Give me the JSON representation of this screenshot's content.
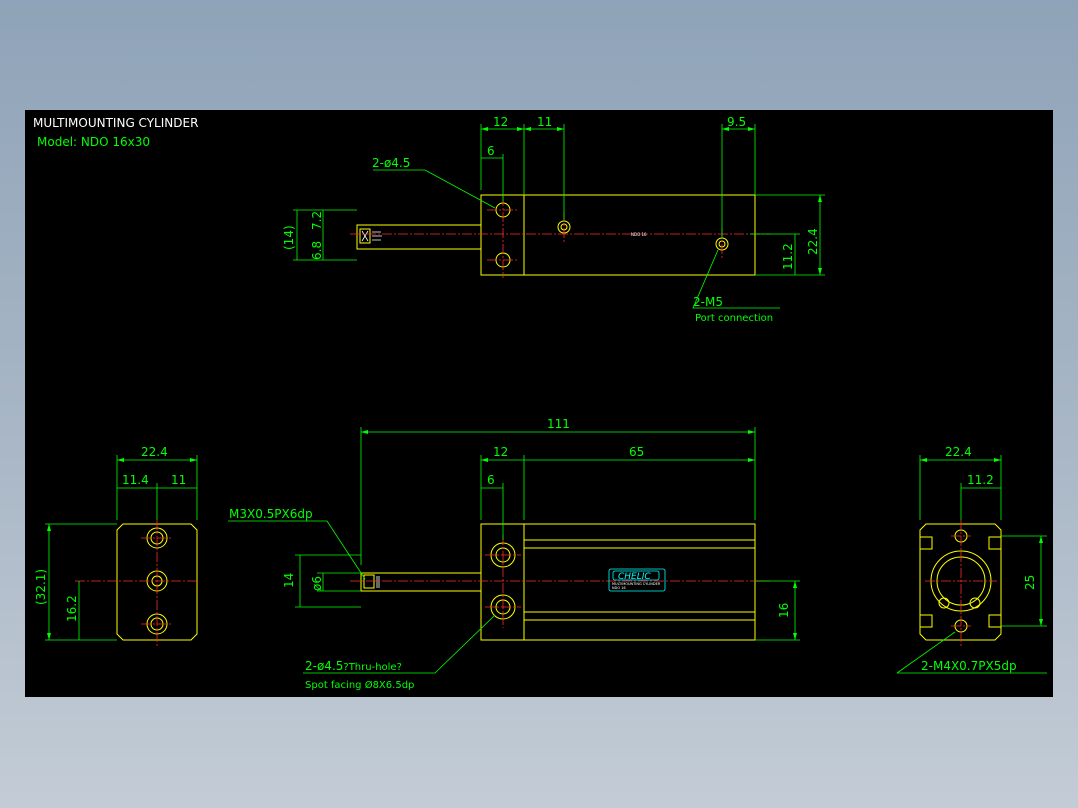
{
  "title": "MULTIMOUNTING CYLINDER",
  "model": "Model:  NDO 16x30",
  "brand_label": "CHELIC",
  "brand_sub": "MULTIMOUNTING CYLINDER",
  "brand_model": "NDO 16",
  "top_view_tag": "NDO 16",
  "top_view": {
    "dim_12": "12",
    "dim_11": "11",
    "dim_9_5": "9.5",
    "dim_6": "6",
    "hole_callout": "2-ø4.5",
    "dim_14": "(14)",
    "dim_7_2": "7.2",
    "dim_6_8": "6.8",
    "dim_22_4": "22.4",
    "dim_11_2": "11.2",
    "port_callout": "2-M5",
    "port_note": "Port connection"
  },
  "front_view": {
    "dim_111": "111",
    "dim_12": "12",
    "dim_65": "65",
    "dim_6": "6",
    "thread_callout": "M3X0.5PX6dp",
    "dim_14": "14",
    "dim_phi6": "ø6",
    "dim_16": "16",
    "hole_callout_a": "2-ø4.5",
    "hole_callout_b": "?Thru-hole?",
    "spot_note": "Spot facing  Ø8X6.5dp"
  },
  "left_view": {
    "dim_22_4": "22.4",
    "dim_11_4": "11.4",
    "dim_11": "11",
    "dim_32_1": "(32.1)",
    "dim_16_2": "16.2"
  },
  "right_view": {
    "dim_22_4": "22.4",
    "dim_11_2": "11.2",
    "dim_25": "25",
    "thread_callout": "2-M4X0.7PX5dp"
  }
}
